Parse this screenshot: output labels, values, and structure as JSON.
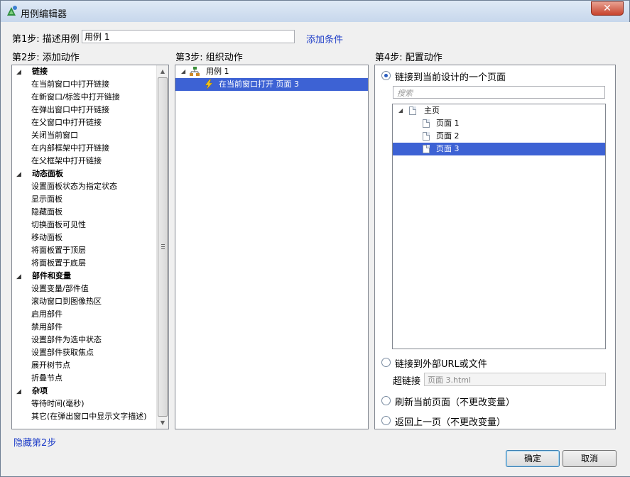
{
  "window": {
    "title": "用例编辑器",
    "close_symbol": "✕"
  },
  "step1": {
    "label": "第1步: 描述用例",
    "case_name": "用例 1",
    "add_condition": "添加条件"
  },
  "step2": {
    "label": "第2步: 添加动作",
    "categories": [
      {
        "name": "链接",
        "items": [
          "在当前窗口中打开链接",
          "在新窗口/标签中打开链接",
          "在弹出窗口中打开链接",
          "在父窗口中打开链接",
          "关闭当前窗口",
          "在内部框架中打开链接",
          "在父框架中打开链接"
        ]
      },
      {
        "name": "动态面板",
        "items": [
          "设置面板状态为指定状态",
          "显示面板",
          "隐藏面板",
          "切换面板可见性",
          "移动面板",
          "将面板置于顶层",
          "将面板置于底层"
        ]
      },
      {
        "name": "部件和变量",
        "items": [
          "设置变量/部件值",
          "滚动窗口到图像热区",
          "启用部件",
          "禁用部件",
          "设置部件为选中状态",
          "设置部件获取焦点",
          "展开树节点",
          "折叠节点"
        ]
      },
      {
        "name": "杂项",
        "items": [
          "等待时间(毫秒)",
          "其它(在弹出窗口中显示文字描述)"
        ]
      }
    ],
    "hide_link": "隐藏第2步"
  },
  "step3": {
    "label": "第3步: 组织动作",
    "case_node": "用例 1",
    "action_node": "在当前窗口打开 页面 3"
  },
  "step4": {
    "label": "第4步: 配置动作",
    "option_page": "链接到当前设计的一个页面",
    "search_placeholder": "搜索",
    "tree": {
      "root": "主页",
      "pages": [
        "页面 1",
        "页面 2",
        "页面 3"
      ],
      "selected": "页面 3"
    },
    "option_url": "链接到外部URL或文件",
    "hyperlink_label": "超链接",
    "hyperlink_value": "页面 3.html",
    "option_refresh": "刷新当前页面（不更改变量）",
    "option_back": "返回上一页（不更改变量）"
  },
  "buttons": {
    "ok": "确定",
    "cancel": "取消"
  },
  "colors": {
    "selection": "#3d62d4",
    "link": "#1f3ec8"
  }
}
